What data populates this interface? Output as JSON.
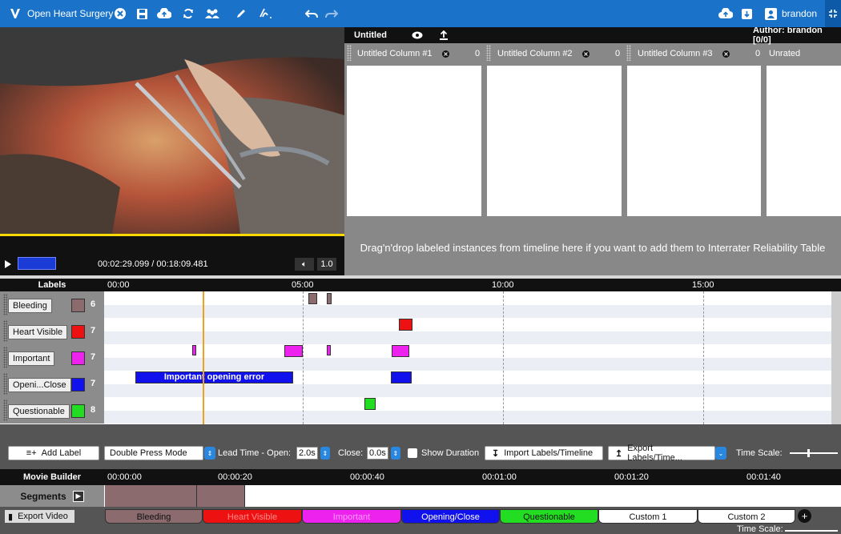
{
  "app": {
    "title": "Open Heart Surgery",
    "user": "brandon"
  },
  "video": {
    "timecode": "00:02:29.099 / 00:18:09.481",
    "speed": "1.0",
    "progress": 0.137
  },
  "irr": {
    "doc_title": "Untitled",
    "author": "Author: brandon [0/0]",
    "columns": [
      {
        "name": "Untitled Column #1",
        "count": "0"
      },
      {
        "name": "Untitled Column #2",
        "count": "0"
      },
      {
        "name": "Untitled Column #3",
        "count": "0"
      },
      {
        "name": "Unrated",
        "count": "0"
      }
    ],
    "drop_message": "Drag'n'drop labeled instances from timeline here if you want to add them to Interrater Reliability Table"
  },
  "timeline": {
    "header": "Labels",
    "ticks": [
      "00:00",
      "05:00",
      "10:00",
      "15:00"
    ],
    "rows": [
      {
        "label": "Bleeding",
        "color": "#8b6b6e",
        "count": "6"
      },
      {
        "label": "Heart Visible",
        "color": "#ee1111",
        "count": "7"
      },
      {
        "label": "Important",
        "color": "#ee22ee",
        "count": "7"
      },
      {
        "label": "Openi...Close",
        "color": "#1111ee",
        "count": "7"
      },
      {
        "label": "Questionable",
        "color": "#22dd22",
        "count": "8"
      }
    ],
    "annotation": "Important opening error"
  },
  "toolbar": {
    "add_label": "Add Label",
    "mode": "Double Press Mode",
    "lead_open_label": "Lead Time - Open:",
    "lead_open_value": "2.0s",
    "close_label": "Close:",
    "close_value": "0.0s",
    "show_duration": "Show Duration",
    "import": "Import Labels/Timeline",
    "export": "Export Labels/Time...",
    "time_scale": "Time Scale:"
  },
  "movie_builder": {
    "title": "Movie Builder",
    "ticks": [
      "00:00:00",
      "00:00:20",
      "00:00:40",
      "00:01:00",
      "00:01:20",
      "00:01:40"
    ],
    "segments_label": "Segments",
    "export_video": "Export Video",
    "legend": [
      {
        "label": "Bleeding",
        "color": "#8b6b6e",
        "text": "#111"
      },
      {
        "label": "Heart Visible",
        "color": "#ee1111",
        "text": "#ff8a8a"
      },
      {
        "label": "Important",
        "color": "#ee22ee",
        "text": "#ff9bff"
      },
      {
        "label": "Opening/Close",
        "color": "#1111ee",
        "text": "#ffffff"
      },
      {
        "label": "Questionable",
        "color": "#22dd22",
        "text": "#111"
      },
      {
        "label": "Custom 1",
        "color": "#ffffff",
        "text": "#111"
      },
      {
        "label": "Custom 2",
        "color": "#ffffff",
        "text": "#111"
      }
    ],
    "time_scale": "Time Scale:"
  }
}
